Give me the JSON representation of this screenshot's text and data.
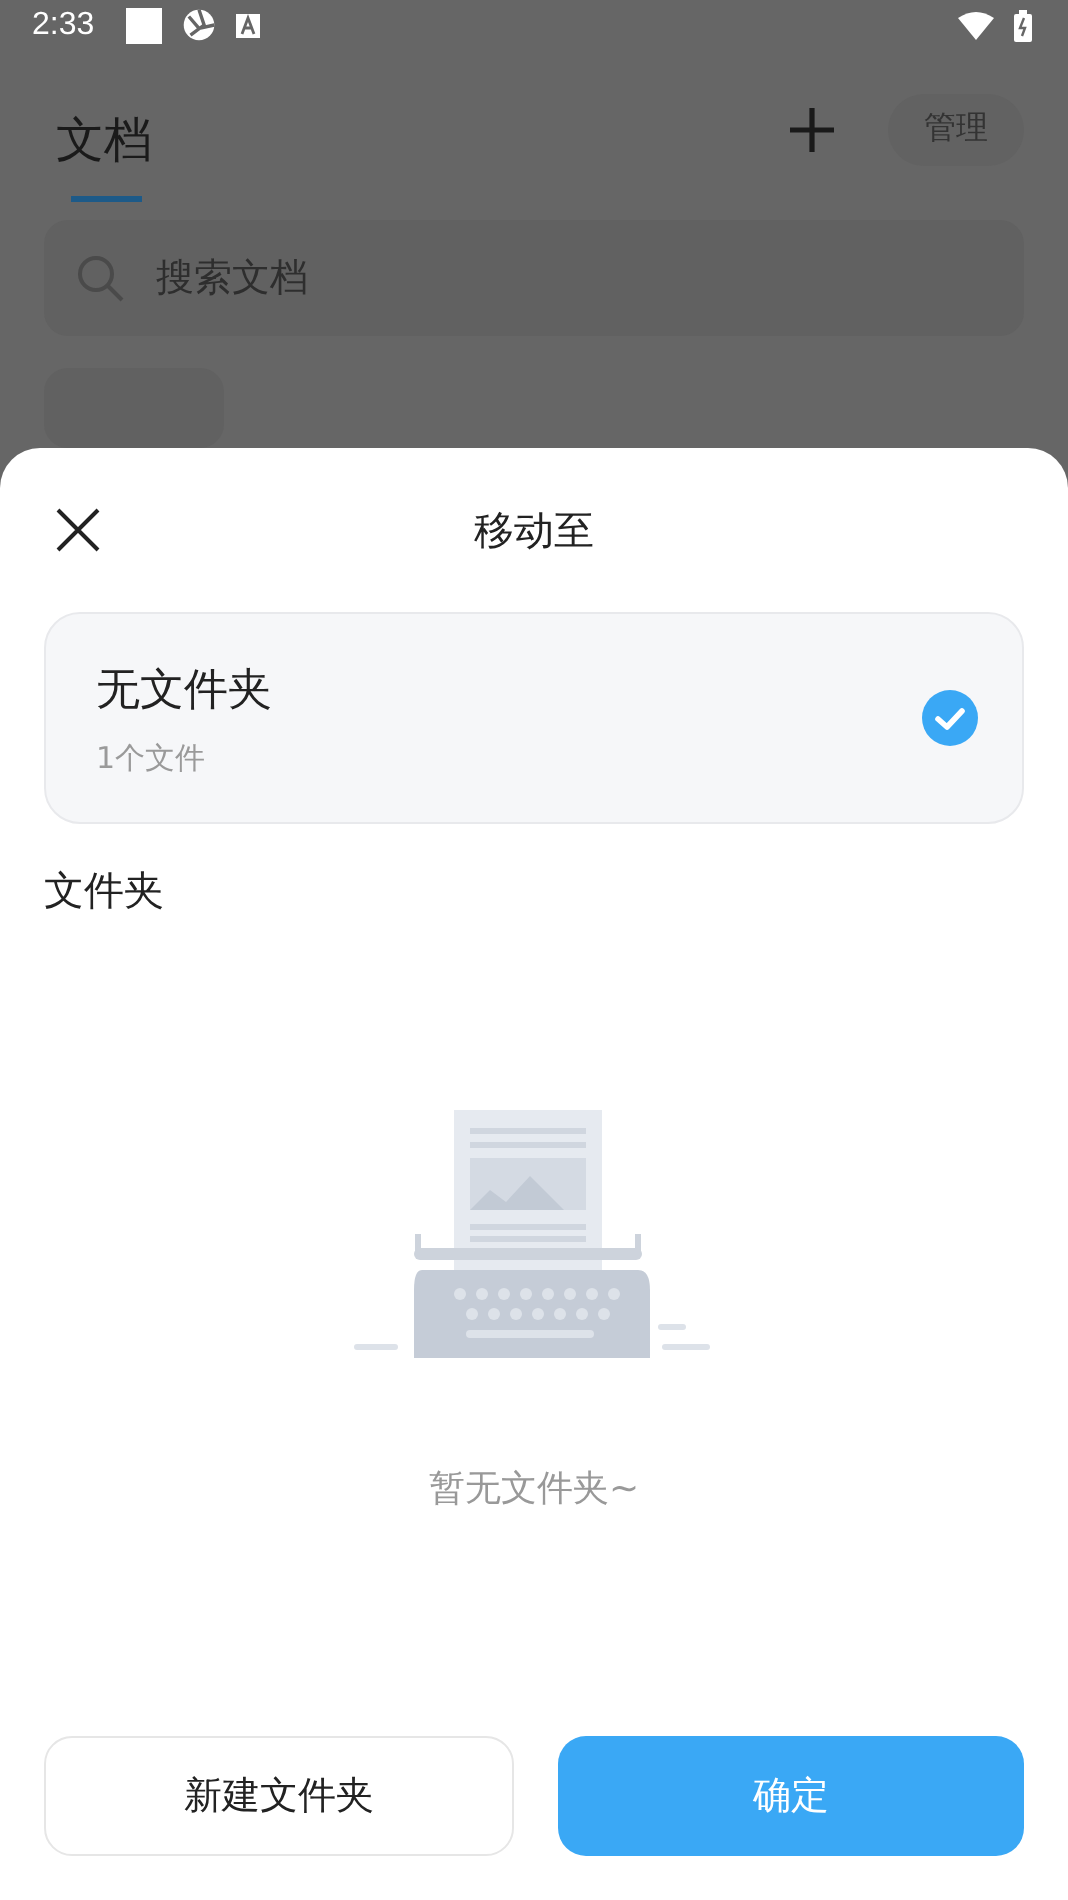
{
  "status_bar": {
    "time": "2:33"
  },
  "background_page": {
    "tabs": [
      {
        "label": "文档",
        "selected": true
      }
    ],
    "manage_button": "管理",
    "search": {
      "placeholder": "搜索文档"
    }
  },
  "sheet": {
    "title": "移动至",
    "options": [
      {
        "name": "无文件夹",
        "count": "1个文件",
        "selected": true
      }
    ],
    "section_title": "文件夹",
    "empty_text": "暂无文件夹~",
    "buttons": [
      {
        "label": "新建文件夹",
        "kind": "secondary"
      },
      {
        "label": "确定",
        "kind": "primary"
      }
    ]
  }
}
